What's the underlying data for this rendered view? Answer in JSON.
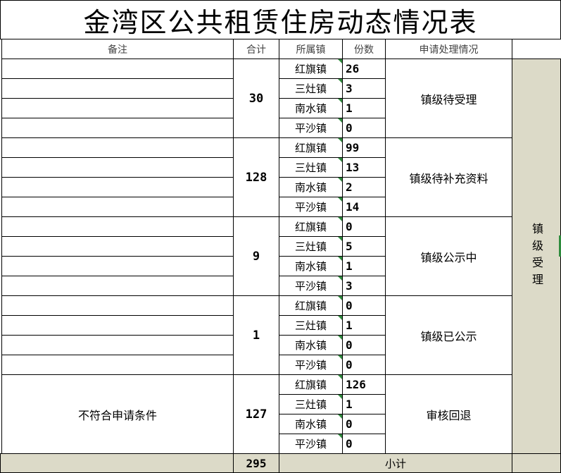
{
  "title": "金湾区公共租赁住房动态情况表",
  "headers": {
    "remarks": "备注",
    "total": "合计",
    "town": "所属镇",
    "count": "份数",
    "status": "申请处理情况"
  },
  "section_label": "镇级受理",
  "groups": [
    {
      "status": "镇级待受理",
      "total": "30",
      "remark": "",
      "rows": [
        {
          "town": "红旗镇",
          "count": "26"
        },
        {
          "town": "三灶镇",
          "count": "3"
        },
        {
          "town": "南水镇",
          "count": "1"
        },
        {
          "town": "平沙镇",
          "count": "0"
        }
      ]
    },
    {
      "status": "镇级待补充资料",
      "total": "128",
      "remark": "",
      "rows": [
        {
          "town": "红旗镇",
          "count": "99"
        },
        {
          "town": "三灶镇",
          "count": "13"
        },
        {
          "town": "南水镇",
          "count": "2"
        },
        {
          "town": "平沙镇",
          "count": "14"
        }
      ]
    },
    {
      "status": "镇级公示中",
      "total": "9",
      "remark": "",
      "rows": [
        {
          "town": "红旗镇",
          "count": "0"
        },
        {
          "town": "三灶镇",
          "count": "5"
        },
        {
          "town": "南水镇",
          "count": "1"
        },
        {
          "town": "平沙镇",
          "count": "3"
        }
      ]
    },
    {
      "status": "镇级已公示",
      "total": "1",
      "remark": "",
      "rows": [
        {
          "town": "红旗镇",
          "count": "0"
        },
        {
          "town": "三灶镇",
          "count": "1"
        },
        {
          "town": "南水镇",
          "count": "0"
        },
        {
          "town": "平沙镇",
          "count": "0"
        }
      ]
    },
    {
      "status": "审核回退",
      "total": "127",
      "remark": "不符合申请条件",
      "rows": [
        {
          "town": "红旗镇",
          "count": "126"
        },
        {
          "town": "三灶镇",
          "count": "1"
        },
        {
          "town": "南水镇",
          "count": "0"
        },
        {
          "town": "平沙镇",
          "count": "0"
        }
      ]
    }
  ],
  "footer": {
    "label": "小计",
    "total": "295"
  }
}
